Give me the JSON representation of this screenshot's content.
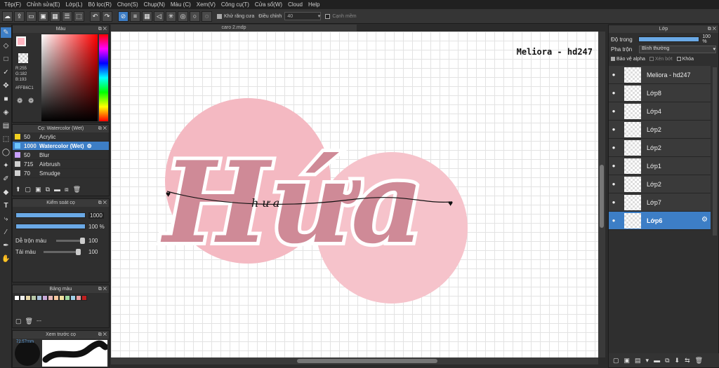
{
  "menu": [
    "Tệp(F)",
    "Chỉnh sửa(E)",
    "Lớp(L)",
    "Bộ lọc(R)",
    "Chọn(S)",
    "Chụp(N)",
    "Màu (C)",
    "Xem(V)",
    "Công cụ(T)",
    "Cửa sổ(W)",
    "Cloud",
    "Help"
  ],
  "toolbar": {
    "antialias_label": "Khử răng cưa",
    "adjust_label": "Điều chỉnh",
    "adjust_value": "40",
    "edge_label": "Cạnh mềm"
  },
  "color_panel": {
    "title": "Màu",
    "r": "R:255",
    "g": "G:182",
    "b": "B:193",
    "hex": "#FFB6C1",
    "fg": "#FFB6C1"
  },
  "brush_panel": {
    "title": "Cọ: Watercolor (Wet)",
    "brushes": [
      {
        "size": "50",
        "name": "Acrylic",
        "color": "#f0d020"
      },
      {
        "size": "1000",
        "name": "Watercolor (Wet)",
        "color": "#6ec6ff"
      },
      {
        "size": "50",
        "name": "Blur",
        "color": "#c8a0ff"
      },
      {
        "size": "715",
        "name": "Airbrush",
        "color": "#d0d0d0"
      },
      {
        "size": "70",
        "name": "Smudge",
        "color": "#d0d0d0"
      }
    ]
  },
  "brush_control": {
    "title": "Kiểm soát cọ",
    "size_value": "1000",
    "opacity_value": "100 %",
    "blend_label": "Dễ trộn màu",
    "blend_value": "100",
    "load_label": "Tải màu",
    "load_value": "100"
  },
  "palette": {
    "title": "Bảng màu",
    "more": "---",
    "colors": [
      "#ffffff",
      "#f0f0f0",
      "#e6d6a8",
      "#b8c9a8",
      "#a8c0d8",
      "#c8a8d8",
      "#e8b8b8",
      "#f8c8a0",
      "#f0e0a0",
      "#a0d8a0",
      "#a0d0e8",
      "#e8a0a0",
      "#c02020"
    ]
  },
  "preview": {
    "title": "Xem trước cọ",
    "zoom": "72.57mm"
  },
  "document": {
    "tab": "caro 2.mdp",
    "signature": "Meliora - hd247",
    "main_text": "Hứa",
    "sub_text": "h ư a"
  },
  "layer_panel": {
    "title": "Lớp",
    "opacity_label": "Độ trong",
    "opacity_value": "100 %",
    "blend_label": "Pha trộn",
    "blend_value": "Bình thường",
    "protect_alpha": "Bảo vệ alpha",
    "clipping": "Xén bớt",
    "lock": "Khóa",
    "layers": [
      {
        "name": "Meliora - hd247",
        "selected": false
      },
      {
        "name": "Lớp8",
        "selected": false
      },
      {
        "name": "Lớp4",
        "selected": false
      },
      {
        "name": "Lớp2",
        "selected": false
      },
      {
        "name": "Lớp2",
        "selected": false
      },
      {
        "name": "Lớp1",
        "selected": false
      },
      {
        "name": "Lớp2",
        "selected": false
      },
      {
        "name": "Lớp7",
        "selected": false
      },
      {
        "name": "Lớp6",
        "selected": true
      }
    ]
  },
  "accent": "#3d7ec6",
  "pink": "#FFB6C1"
}
